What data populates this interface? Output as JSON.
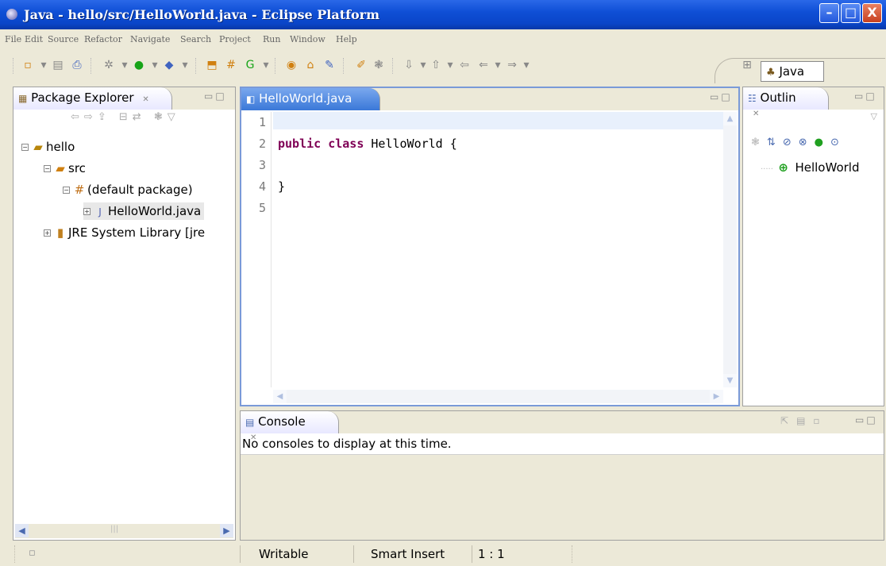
{
  "window": {
    "title": "Java - hello/src/HelloWorld.java - Eclipse Platform",
    "minimize": "–",
    "maximize": "□",
    "close": "X"
  },
  "menu": [
    "File",
    "Edit",
    "Source",
    "Refactor",
    "Navigate",
    "Search",
    "Project",
    "Run",
    "Window",
    "Help"
  ],
  "perspective": {
    "label": "Java"
  },
  "package_explorer": {
    "tab": "Package Explorer",
    "tree": [
      {
        "label": "hello",
        "icon": "project-icon",
        "expander": "⊟"
      },
      {
        "label": "src",
        "icon": "source-folder-icon",
        "expander": "⊟"
      },
      {
        "label": "(default package)",
        "icon": "package-icon",
        "expander": "⊟"
      },
      {
        "label": "HelloWorld.java",
        "icon": "java-file-icon",
        "expander": "⊞"
      },
      {
        "label": "JRE System Library [jre",
        "icon": "library-icon",
        "expander": "⊞"
      }
    ]
  },
  "editor": {
    "tab": "HelloWorld.java",
    "line_numbers": [
      "1",
      "2",
      "3",
      "4",
      "5"
    ],
    "lines": [
      {
        "kw": "",
        "text": ""
      },
      {
        "kw": "public class",
        "text": " HelloWorld {"
      },
      {
        "kw": "",
        "text": ""
      },
      {
        "kw": "",
        "text": "}"
      },
      {
        "kw": "",
        "text": ""
      }
    ]
  },
  "outline": {
    "tab": "Outlin",
    "items": [
      {
        "label": "HelloWorld",
        "icon": "class-icon"
      }
    ]
  },
  "console": {
    "tab": "Console",
    "message": "No consoles to display at this time."
  },
  "status": {
    "writable": "Writable",
    "insert_mode": "Smart Insert",
    "position": "1 : 1"
  }
}
